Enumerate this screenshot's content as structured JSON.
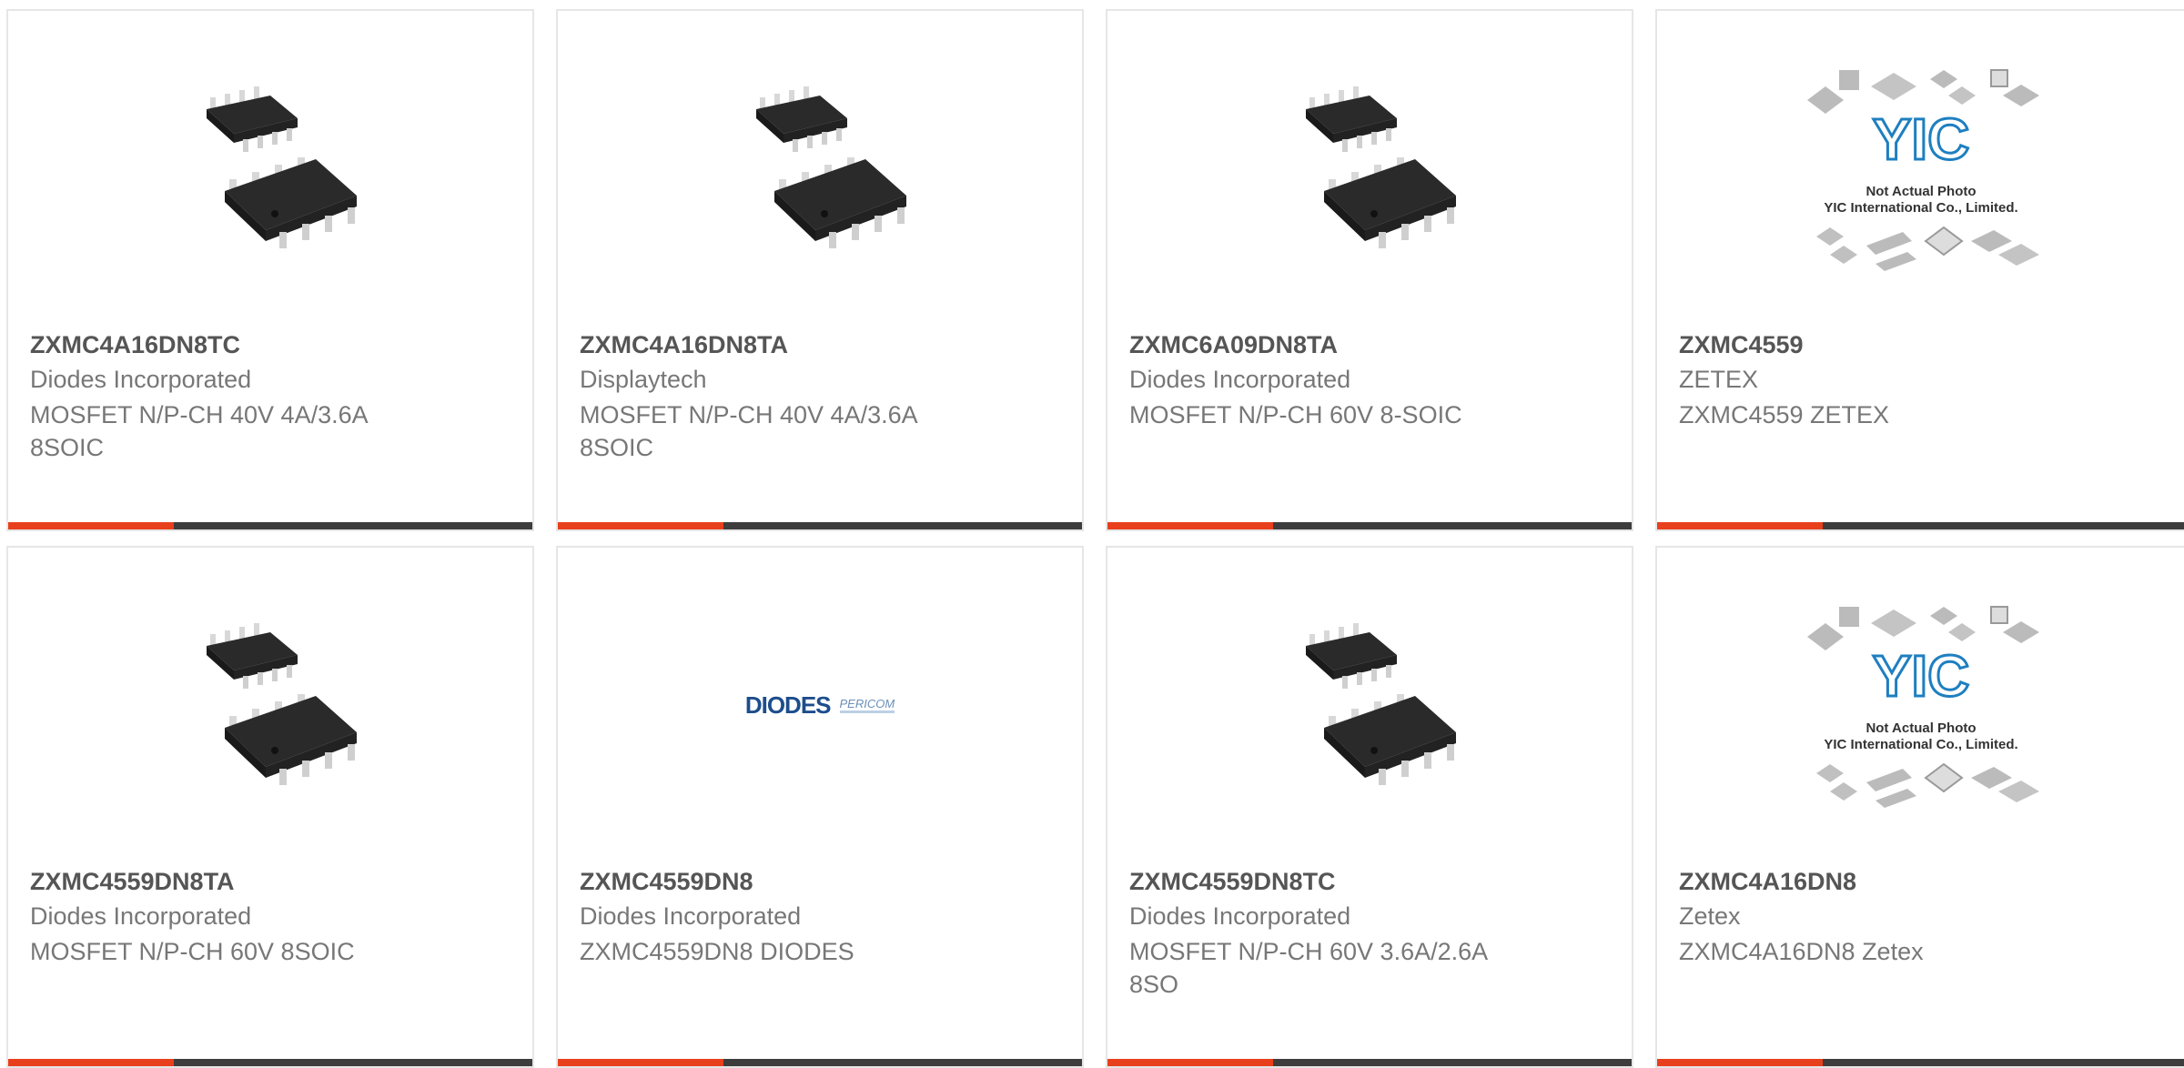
{
  "colors": {
    "accent": "#e8401c",
    "bar": "#3d3d3d",
    "border": "#e6e6e6"
  },
  "products": [
    {
      "part": "ZXMC4A16DN8TC",
      "manufacturer": "Diodes Incorporated",
      "description": "MOSFET N/P-CH 40V 4A/3.6A 8SOIC",
      "image": "soic-chip"
    },
    {
      "part": "ZXMC4A16DN8TA",
      "manufacturer": "Displaytech",
      "description": "MOSFET N/P-CH 40V 4A/3.6A 8SOIC",
      "image": "soic-chip"
    },
    {
      "part": "ZXMC6A09DN8TA",
      "manufacturer": "Diodes Incorporated",
      "description": "MOSFET N/P-CH 60V 8-SOIC",
      "image": "soic-chip"
    },
    {
      "part": "ZXMC4559",
      "manufacturer": "ZETEX",
      "description": "ZXMC4559 ZETEX",
      "image": "not-actual-photo"
    },
    {
      "part": "ZXMC4559DN8TA",
      "manufacturer": "Diodes Incorporated",
      "description": "MOSFET N/P-CH 60V 8SOIC",
      "image": "soic-chip"
    },
    {
      "part": "ZXMC4559DN8",
      "manufacturer": "Diodes Incorporated",
      "description": "ZXMC4559DN8 DIODES",
      "image": "diodes-logo"
    },
    {
      "part": "ZXMC4559DN8TC",
      "manufacturer": "Diodes Incorporated",
      "description": "MOSFET N/P-CH 60V 3.6A/2.6A 8SO",
      "image": "soic-chip"
    },
    {
      "part": "ZXMC4A16DN8",
      "manufacturer": "Zetex",
      "description": "ZXMC4A16DN8 Zetex",
      "image": "not-actual-photo"
    }
  ],
  "placeholder": {
    "brand": "YIC",
    "line1": "Not Actual Photo",
    "line2": "YIC International Co., Limited."
  },
  "diodes_logo": {
    "main": "DIODES",
    "secondary": "PERICOM"
  }
}
